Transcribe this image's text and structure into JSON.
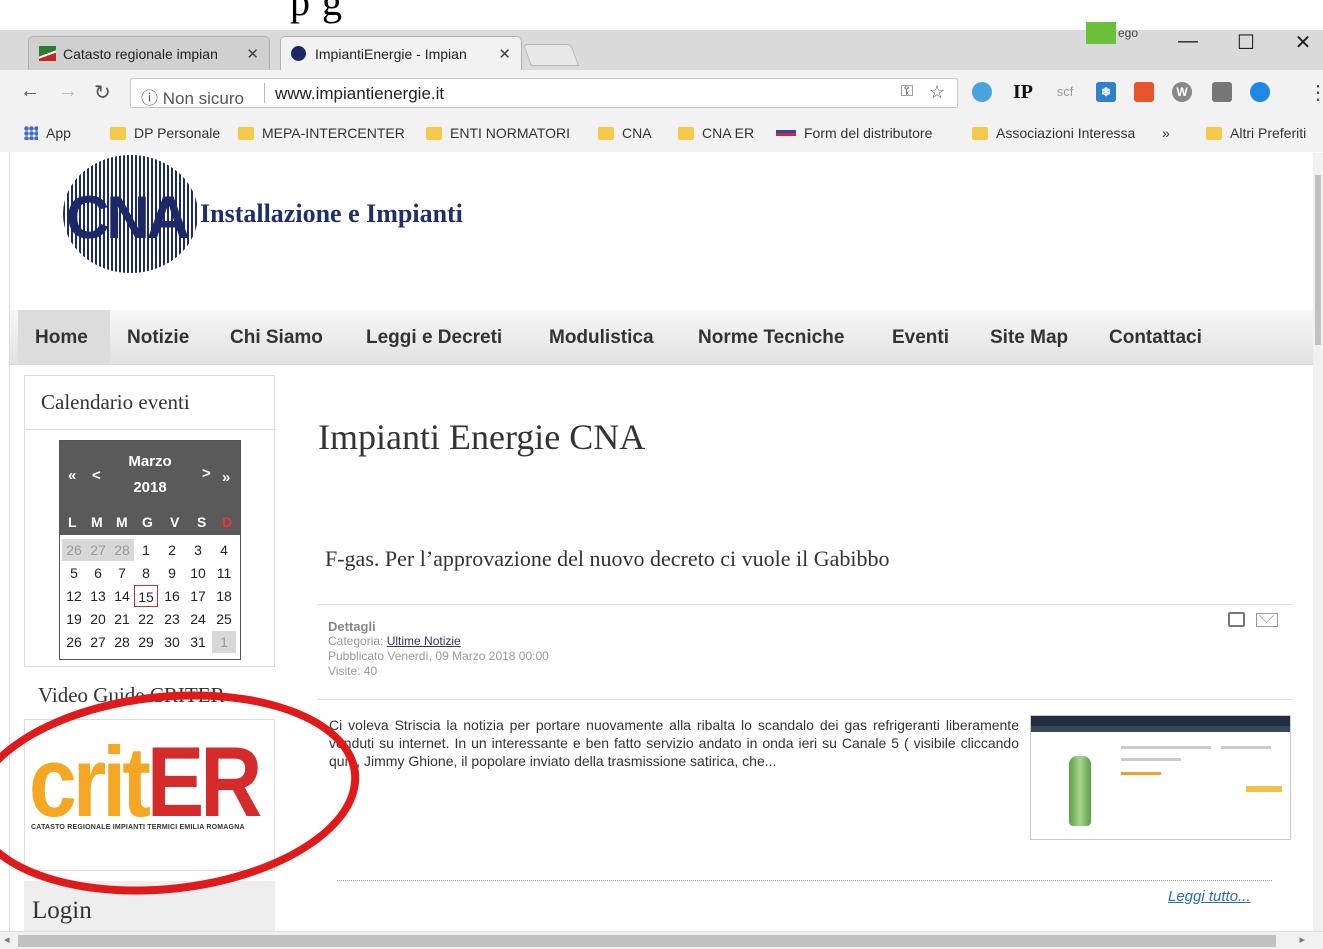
{
  "browser": {
    "tabs": [
      {
        "title": "Catasto regionale impian",
        "close": "✕"
      },
      {
        "title": "ImpiantiEnergie - Impian",
        "close": "✕"
      }
    ],
    "profile_label": "ego",
    "window_buttons": [
      "—",
      "☐",
      "✕"
    ],
    "security_label": "ⓘ Non sicuro",
    "url": "www.impiantienergie.it",
    "extensions": [
      "IP",
      "scf"
    ],
    "bookmarks": [
      {
        "label": "App",
        "icon": "apps-grid-icon"
      },
      {
        "label": "DP Personale",
        "icon": "folder-icon"
      },
      {
        "label": "MEPA-INTERCENTER",
        "icon": "folder-icon"
      },
      {
        "label": "ENTI NORMATORI",
        "icon": "folder-icon"
      },
      {
        "label": "CNA",
        "icon": "folder-icon"
      },
      {
        "label": "CNA ER",
        "icon": "folder-icon"
      },
      {
        "label": "Form del distributore",
        "icon": "form-icon"
      },
      {
        "label": "Associazioni Interessa",
        "icon": "folder-icon"
      }
    ],
    "more_bookmarks": "»",
    "other_bookmarks": "Altri Preferiti"
  },
  "site": {
    "logo_text": "CNA",
    "tagline": "Installazione e Impianti",
    "nav": [
      "Home",
      "Notizie",
      "Chi Siamo",
      "Leggi e Decreti",
      "Modulistica",
      "Norme Tecniche",
      "Eventi",
      "Site Map",
      "Contattaci"
    ]
  },
  "sidebar": {
    "calendar_title": "Calendario eventi",
    "calendar": {
      "month": "Marzo",
      "year": "2018",
      "prev_year": "«",
      "prev_month": "<",
      "next_month": ">",
      "next_year": "»",
      "weekdays": [
        "L",
        "M",
        "M",
        "G",
        "V",
        "S",
        "D"
      ],
      "weeks": [
        [
          "26",
          "27",
          "28",
          "1",
          "2",
          "3",
          "4"
        ],
        [
          "5",
          "6",
          "7",
          "8",
          "9",
          "10",
          "11"
        ],
        [
          "12",
          "13",
          "14",
          "15",
          "16",
          "17",
          "18"
        ],
        [
          "19",
          "20",
          "21",
          "22",
          "23",
          "24",
          "25"
        ],
        [
          "26",
          "27",
          "28",
          "29",
          "30",
          "31",
          "1"
        ]
      ],
      "today": "15"
    },
    "video_title": "Video Guide CRITER",
    "criter_logo_a": "crit",
    "criter_logo_b": "ER",
    "criter_subtitle": "CATASTO REGIONALE IMPIANTI TERMICI EMILIA ROMAGNA",
    "login_title": "Login"
  },
  "main": {
    "page_title": "Impianti Energie CNA",
    "article": {
      "title": "F-gas. Per l’approvazione del nuovo decreto ci vuole il Gabibbo",
      "details_label": "Dettagli",
      "category_label": "Categoria: ",
      "category": "Ultime Notizie",
      "published": "Pubblicato Venerdì, 09 Marzo 2018 00:00",
      "visits": "Visite: 40",
      "excerpt": "Ci voleva Striscia la notizia per portare nuovamente alla ribalta lo scandalo dei gas refrigeranti liberamente venduti su internet. In un interessante e ben fatto servizio andato in onda ieri su Canale 5 ( visibile cliccando qui ), Jimmy Ghione, il popolare inviato della trasmissione satirica, che...",
      "read_more": "Leggi tutto..."
    }
  }
}
